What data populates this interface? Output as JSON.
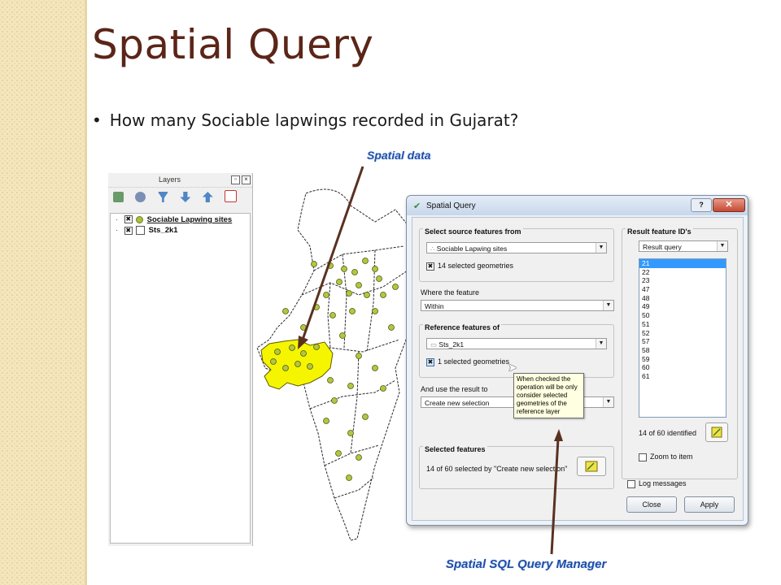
{
  "slide": {
    "title": "Spatial Query",
    "bullet": "How many Sociable lapwings recorded in Gujarat?",
    "callout_spatial_data": "Spatial data",
    "callout_query_manager": "Spatial SQL Query Manager",
    "colors": {
      "title": "#5b2518",
      "callout": "#1f4ea8",
      "gujarat_fill": "#f5f500",
      "site_points": "#b4c63f"
    }
  },
  "layers_panel": {
    "title": "Layers",
    "toolbar_icons": [
      "add-group-icon",
      "visibility-icon",
      "filter-icon",
      "expand-icon",
      "collapse-icon",
      "remove-layer-icon"
    ],
    "layers": [
      {
        "checked": true,
        "symbol": "point",
        "name": "Sociable Lapwing sites"
      },
      {
        "checked": true,
        "symbol": "polygon",
        "name": "Sts_2k1"
      }
    ]
  },
  "dialog": {
    "title": "Spatial Query",
    "help_label": "?",
    "close_icon": "✕",
    "source_group": {
      "label": "Select source features from",
      "layer": "Sociable Lapwing sites",
      "use_selected_checked": true,
      "use_selected_label": "14 selected geometries"
    },
    "where_label": "Where the feature",
    "operation": "Within",
    "reference_group": {
      "label": "Reference features of",
      "layer": "Sts_2k1",
      "use_selected_checked": true,
      "use_selected_label": "1 selected geometries"
    },
    "result_label": "And use the result to",
    "result_action": "Create new selection",
    "selected_group": {
      "label": "Selected features",
      "summary": "14 of 60 selected by \"Create new selection\""
    },
    "result_ids_group": {
      "label": "Result feature ID's",
      "dropdown": "Result query",
      "ids": [
        "21",
        "22",
        "23",
        "47",
        "48",
        "49",
        "50",
        "51",
        "52",
        "57",
        "58",
        "59",
        "60",
        "61"
      ],
      "selected_id": "21",
      "identified": "14 of 60 identified",
      "zoom_label": "Zoom to item",
      "zoom_checked": false
    },
    "log_label": "Log messages",
    "log_checked": false,
    "close_button": "Close",
    "apply_button": "Apply"
  },
  "tooltip": {
    "text": "When checked the operation will be only consider selected geometries of the reference layer"
  }
}
